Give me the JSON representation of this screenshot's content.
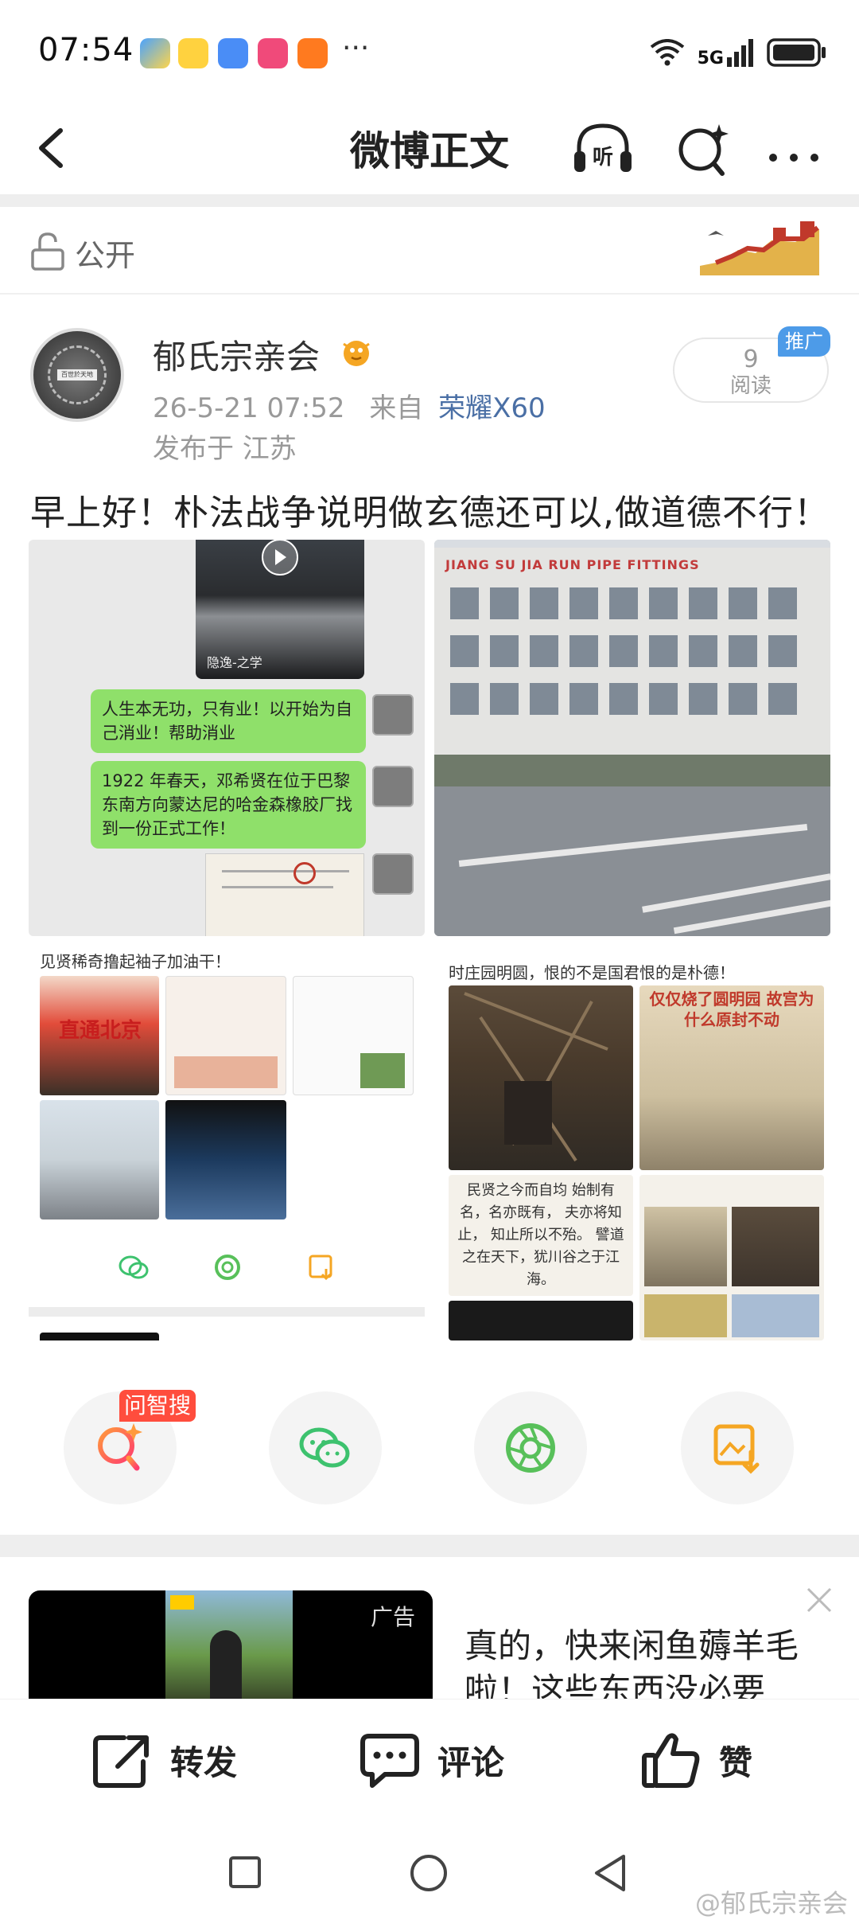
{
  "status_bar": {
    "time": "07:54",
    "network": "5G",
    "more_dots": "···"
  },
  "nav": {
    "title": "微博正文",
    "listen_label": "听"
  },
  "visibility": {
    "label": "公开"
  },
  "post": {
    "author": "郁氏宗亲会",
    "datetime": "26-5-21 07:52",
    "source_prefix": "来自",
    "source_device": "荣耀X60",
    "location": "发布于 江苏",
    "read_count": "9",
    "read_label": "阅读",
    "promo_badge": "推广",
    "text": "早上好！朴法战争说明做玄德还可以,做道德不行！",
    "avatar_text": "百世於天地"
  },
  "images": {
    "img1": {
      "video_caption": "隐逸-之学",
      "bubble1": "人生本无功，只有业！以开始为自己消业！帮助消业",
      "bubble2": "1922 年春天，邓希贤在位于巴黎东南方向蒙达尼的哈金森橡胶厂找到一份正式工作！"
    },
    "img2": {
      "sign_text": "JIANG SU JIA  RUN  PIPE FITTINGS"
    },
    "img3": {
      "caption": "见贤稀奇撸起袖子加油干！",
      "banner": "直通北京"
    },
    "img4": {
      "caption": "时庄园明圆，恨的不是国君恨的是朴德！",
      "banner": "仅仅烧了圆明园 故宫为什么原封不动",
      "poem": "民贤之今而自均 始制有名，名亦既有， 夫亦将知止， 知止所以不殆。 譬道之在天下，犹川谷之于江海。"
    }
  },
  "actions": {
    "ask_badge": "问智搜"
  },
  "ad": {
    "label": "广告",
    "text": "真的，快来闲鱼薅羊毛啦！这些东西没必要"
  },
  "bottom_bar": {
    "repost": "转发",
    "comment": "评论",
    "like": "赞"
  },
  "watermark": "@郁氏宗亲会",
  "colors": {
    "link_blue": "#4a6fa5",
    "promo_blue": "#4d9be8",
    "ask_red": "#ff4d3d",
    "wechat_green": "#3dc26e",
    "camera_green": "#58c05a",
    "save_orange": "#f5a623"
  }
}
